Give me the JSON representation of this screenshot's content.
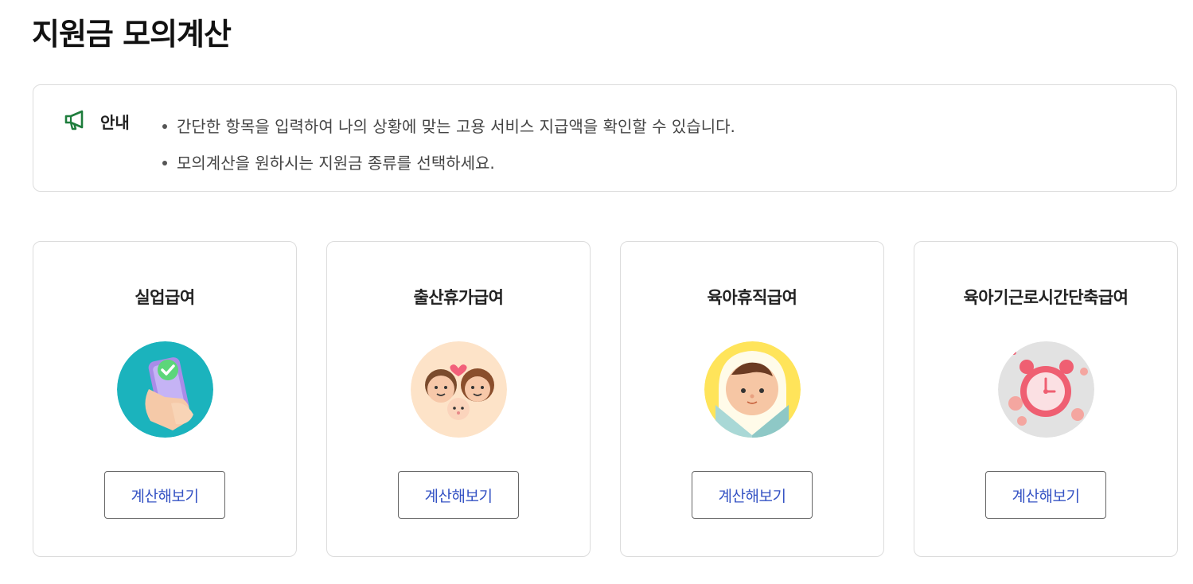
{
  "page": {
    "title": "지원금 모의계산"
  },
  "notice": {
    "icon": "megaphone-icon",
    "label": "안내",
    "items": [
      "간단한 항목을 입력하여 나의 상황에 맞는 고용 서비스 지급액을 확인할 수 있습니다.",
      "모의계산을 원하시는 지원금 종류를 선택하세요."
    ]
  },
  "cards": [
    {
      "title": "실업급여",
      "image": "phone-check-icon",
      "button": "계산해보기",
      "bg": "#1bb3bd"
    },
    {
      "title": "출산휴가급여",
      "image": "family-icon",
      "button": "계산해보기",
      "bg": "#fde3c8"
    },
    {
      "title": "육아휴직급여",
      "image": "baby-icon",
      "button": "계산해보기",
      "bg": "#ffe45a"
    },
    {
      "title": "육아기근로시간단축급여",
      "image": "alarm-clock-coins-icon",
      "button": "계산해보기",
      "bg": "#e2e2e2"
    }
  ],
  "colors": {
    "accent_green": "#1e7d3c",
    "button_text": "#3553c4",
    "border": "#dcdcdc"
  }
}
